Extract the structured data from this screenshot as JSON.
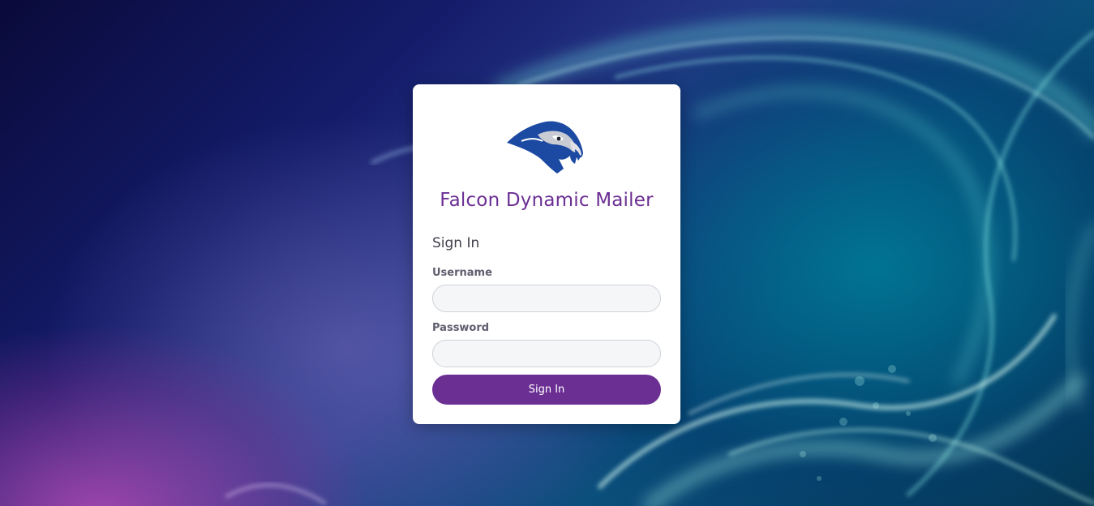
{
  "app": {
    "title": "Falcon Dynamic Mailer",
    "logo_icon": "falcon-head-icon"
  },
  "form": {
    "heading": "Sign In",
    "username_label": "Username",
    "username_value": "",
    "password_label": "Password",
    "password_value": "",
    "submit_label": "Sign In"
  },
  "colors": {
    "accent": "#6b2f93",
    "card": "#ffffff",
    "input_bg": "#f5f6f8",
    "logo_blue": "#1c4aa3"
  }
}
